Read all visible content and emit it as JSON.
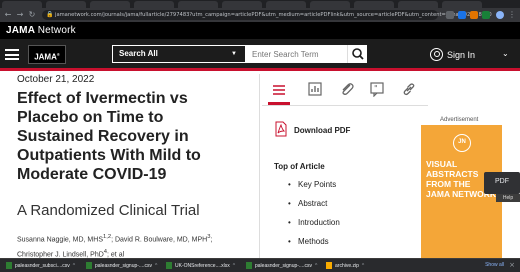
{
  "browser": {
    "url": "jamanetwork.com/journals/jama/fullarticle/2797483?utm_campaign=articlePDF&utm_medium=articlePDFlink&utm_source=articlePDF&utm_content=jama.2022.18590"
  },
  "network_bar": {
    "brand_bold": "JAMA",
    "brand_normal": "Network",
    "trademark": "®"
  },
  "header": {
    "logo": "JAMA",
    "search_scope": "Search All",
    "search_placeholder": "Enter Search Term",
    "sign_in": "Sign In"
  },
  "article": {
    "date": "October 21, 2022",
    "title": "Effect of Ivermectin vs Placebo on Time to Sustained Recovery in Outpatients With Mild to Moderate COVID-19",
    "subtitle": "A Randomized Clinical Trial",
    "authors_line1": "Susanna Naggie, MD, MHS",
    "authors_line1_sup": "1,2",
    "authors_line1_b": "; David R. Boulware, MD, MPH",
    "authors_line1_b_sup": "3",
    "authors_line1_end": ";",
    "authors_line2": "Christopher J. Lindsell, PhD",
    "authors_line2_sup": "4",
    "authors_line2_b": "; ",
    "authors_et_al": "et al"
  },
  "sidebar": {
    "download_pdf": "Download PDF",
    "toc_heading": "Top of Article",
    "toc_items": [
      "Key Points",
      "Abstract",
      "Introduction",
      "Methods"
    ]
  },
  "ad": {
    "label": "Advertisement",
    "logo": "JN",
    "lines": [
      "VISUAL",
      "ABSTRACTS",
      "FROM THE",
      "JAMA NETWORK"
    ]
  },
  "overlay": {
    "pdf": "PDF",
    "help": "Help"
  },
  "downloads": {
    "items": [
      "paleasnder_subsci....csv",
      "paleasnder_signup-....csv",
      "UK-ONSreference....xlsx",
      "paleasnder_signup-....csv",
      "archive.zip"
    ],
    "show_all": "Show all"
  },
  "colors": {
    "accent": "#c8102e",
    "ad": "#f4a638",
    "header": "#1c1c1c"
  }
}
